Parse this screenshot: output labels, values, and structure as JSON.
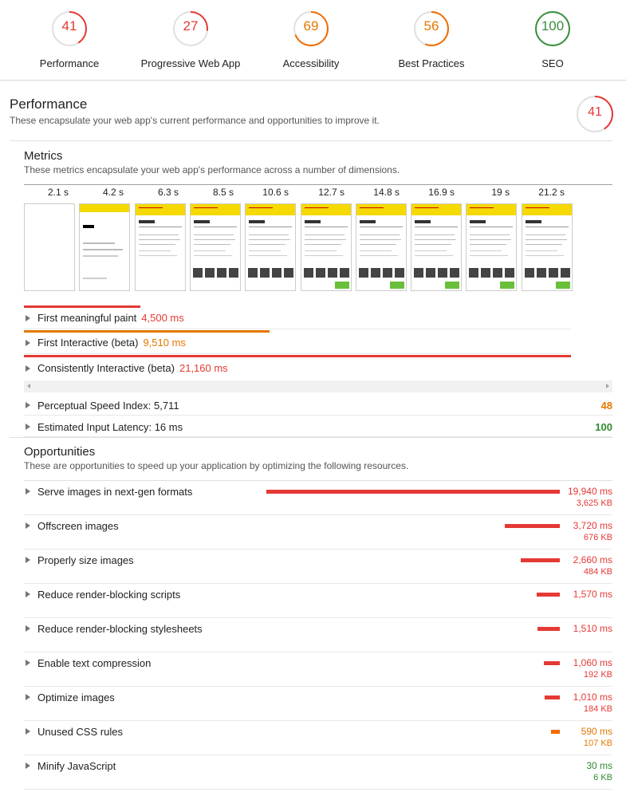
{
  "colors": {
    "fail": "#e53935",
    "average": "#ef6c00",
    "pass": "#388e3c",
    "track": "#e0e0e0"
  },
  "categories": [
    {
      "score": "41",
      "label": "Performance",
      "color": "#e53935",
      "fraction": 0.41
    },
    {
      "score": "27",
      "label": "Progressive Web App",
      "color": "#e53935",
      "fraction": 0.27
    },
    {
      "score": "69",
      "label": "Accessibility",
      "color": "#ef6c00",
      "fraction": 0.69
    },
    {
      "score": "56",
      "label": "Best Practices",
      "color": "#ef6c00",
      "fraction": 0.56
    },
    {
      "score": "100",
      "label": "SEO",
      "color": "#388e3c",
      "fraction": 1.0
    }
  ],
  "performance": {
    "title": "Performance",
    "description": "These encapsulate your web app's current performance and opportunities to improve it.",
    "score": "41",
    "fraction": 0.41
  },
  "metrics": {
    "title": "Metrics",
    "description": "These metrics encapsulate your web app's performance across a number of dimensions.",
    "filmstrip_times": [
      "2.1 s",
      "4.2 s",
      "6.3 s",
      "8.5 s",
      "10.6 s",
      "12.7 s",
      "14.8 s",
      "16.9 s",
      "19 s",
      "21.2 s"
    ],
    "timeline": [
      {
        "label": "First meaningful paint",
        "value": "4,500 ms",
        "color": "#e53935",
        "ms": 4500
      },
      {
        "label": "First Interactive (beta)",
        "value": "9,510 ms",
        "color": "#e67700",
        "ms": 9510
      },
      {
        "label": "Consistently Interactive (beta)",
        "value": "21,160 ms",
        "color": "#e53935",
        "ms": 21160
      }
    ],
    "scored": [
      {
        "label": "Perceptual Speed Index: 5,711",
        "score": "48",
        "color": "#e67700"
      },
      {
        "label": "Estimated Input Latency: 16 ms",
        "score": "100",
        "color": "#2e8b2e"
      }
    ]
  },
  "opportunities": {
    "title": "Opportunities",
    "description": "These are opportunities to speed up your application by optimizing the following resources.",
    "items": [
      {
        "label": "Serve images in next-gen formats",
        "ms": "19,940 ms",
        "kb": "3,625 KB",
        "value": 19940,
        "color": "#e53935"
      },
      {
        "label": "Offscreen images",
        "ms": "3,720 ms",
        "kb": "676 KB",
        "value": 3720,
        "color": "#e53935"
      },
      {
        "label": "Properly size images",
        "ms": "2,660 ms",
        "kb": "484 KB",
        "value": 2660,
        "color": "#e53935"
      },
      {
        "label": "Reduce render-blocking scripts",
        "ms": "1,570 ms",
        "kb": "",
        "value": 1570,
        "color": "#e53935"
      },
      {
        "label": "Reduce render-blocking stylesheets",
        "ms": "1,510 ms",
        "kb": "",
        "value": 1510,
        "color": "#e53935"
      },
      {
        "label": "Enable text compression",
        "ms": "1,060 ms",
        "kb": "192 KB",
        "value": 1060,
        "color": "#e53935"
      },
      {
        "label": "Optimize images",
        "ms": "1,010 ms",
        "kb": "184 KB",
        "value": 1010,
        "color": "#e53935"
      },
      {
        "label": "Unused CSS rules",
        "ms": "590 ms",
        "kb": "107 KB",
        "value": 590,
        "color": "#ef6c00"
      },
      {
        "label": "Minify JavaScript",
        "ms": "30 ms",
        "kb": "6 KB",
        "value": 30,
        "color": "#2e8b2e"
      }
    ]
  }
}
